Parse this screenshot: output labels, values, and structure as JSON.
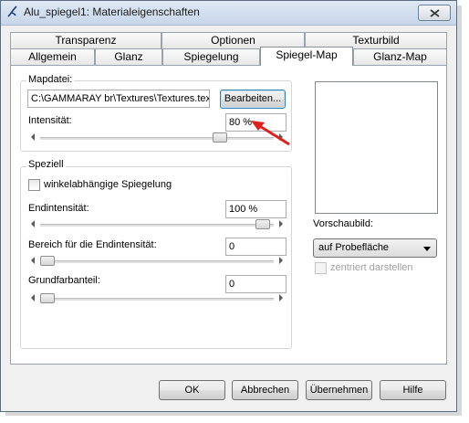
{
  "window": {
    "title": "Alu_spiegel1: Materialeigenschaften"
  },
  "tabs_top": [
    {
      "label": "Transparenz"
    },
    {
      "label": "Optionen"
    },
    {
      "label": "Texturbild"
    }
  ],
  "tabs_bottom": [
    {
      "label": "Allgemein"
    },
    {
      "label": "Glanz"
    },
    {
      "label": "Spiegelung"
    },
    {
      "label": "Spiegel-Map",
      "active": true
    },
    {
      "label": "Glanz-Map"
    }
  ],
  "mapdatei": {
    "label": "Mapdatei:",
    "path_value": "C:\\GAMMARAY br\\Textures\\Textures.tex",
    "edit_button": "Bearbeiten...",
    "intensity_label": "Intensität:",
    "intensity_value": "80 %",
    "intensity_level": 0.8
  },
  "speziell": {
    "label": "Speziell",
    "angle_checkbox_label": "winkelabhängige Spiegelung",
    "angle_checked": false,
    "end_intensity_label": "Endintensität:",
    "end_intensity_value": "100 %",
    "end_intensity_level": 1.0,
    "range_label": "Bereich für die Endintensität:",
    "range_value": "0",
    "range_level": 0,
    "base_color_label": "Grundfarbanteil:",
    "base_color_value": "0",
    "base_color_level": 0
  },
  "preview": {
    "label": "Vorschaubild:",
    "mode_selected": "auf Probefläche",
    "center_label": "zentriert darstellen",
    "center_checked": false
  },
  "footer": {
    "ok": "OK",
    "cancel": "Abbrechen",
    "apply": "Übernehmen",
    "help": "Hilfe"
  },
  "colors": {
    "annotation_arrow": "#e0201b",
    "titlebar": "#c7d6ea",
    "accent": "#3c7fb1"
  }
}
